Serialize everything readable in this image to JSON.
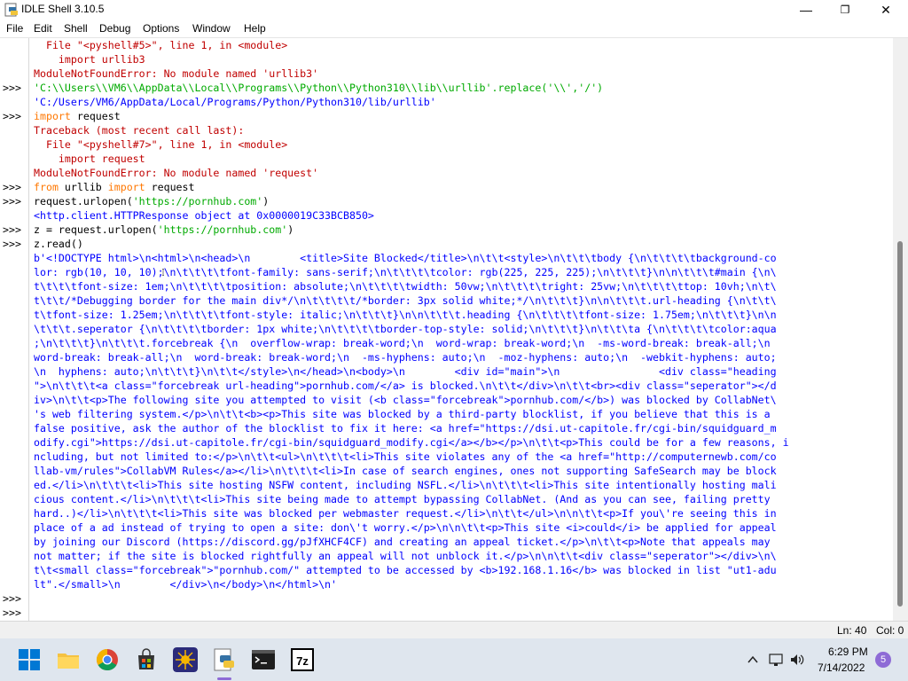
{
  "window": {
    "title": "IDLE Shell 3.10.5",
    "controls": {
      "minimize": "—",
      "maximize": "❐",
      "close": "✕"
    }
  },
  "menu": [
    "File",
    "Edit",
    "Shell",
    "Debug",
    "Options",
    "Window",
    "Help"
  ],
  "shell": {
    "prompts": [
      ">>>",
      ">>>",
      ">>>",
      ">>>",
      ">>>",
      ">>>",
      ">>>",
      ">>>"
    ],
    "lines": [
      {
        "cls": "c-red",
        "text": "  File \"<pyshell#5>\", line 1, in <module>"
      },
      {
        "cls": "c-red",
        "text": "    import urllib3"
      },
      {
        "cls": "c-red",
        "text": "ModuleNotFoundError: No module named 'urllib3'"
      },
      {
        "cls": "c-grn",
        "text": "'C:\\\\Users\\\\VM6\\\\AppData\\\\Local\\\\Programs\\\\Python\\\\Python310\\\\lib\\\\urllib'.replace('\\\\','/')"
      },
      {
        "cls": "c-blue",
        "text": "'C:/Users/VM6/AppData/Local/Programs/Python/Python310/lib/urllib'"
      },
      {
        "cls": "c-blk",
        "text": "import request"
      },
      {
        "cls": "c-red",
        "text": "Traceback (most recent call last):"
      },
      {
        "cls": "c-red",
        "text": "  File \"<pyshell#7>\", line 1, in <module>"
      },
      {
        "cls": "c-red",
        "text": "    import request"
      },
      {
        "cls": "c-red",
        "text": "ModuleNotFoundError: No module named 'request'"
      },
      {
        "cls": "c-blk",
        "text": "from urllib import request"
      },
      {
        "cls": "c-blk",
        "text": "request.urlopen('https://pornhub.com')"
      },
      {
        "cls": "c-blue",
        "text": "<http.client.HTTPResponse object at 0x0000019C33BCB850>"
      },
      {
        "cls": "c-blk",
        "text": "z = request.urlopen('https://pornhub.com')"
      },
      {
        "cls": "c-blk",
        "text": "z.read()"
      },
      {
        "cls": "c-blue",
        "text": "b'<!DOCTYPE html>\\n<html>\\n<head>\\n        <title>Site Blocked</title>\\n\\t\\t<style>\\n\\t\\t\\tbody {\\n\\t\\t\\t\\tbackground-co"
      },
      {
        "cls": "c-blue",
        "text": "lor: rgb(10, 10, 10);\\n\\t\\t\\t\\tfont-family: sans-serif;\\n\\t\\t\\t\\tcolor: rgb(225, 225, 225);\\n\\t\\t\\t}\\n\\n\\t\\t\\t#main {\\n\\"
      },
      {
        "cls": "c-blue",
        "text": "t\\t\\t\\tfont-size: 1em;\\n\\t\\t\\t\\tposition: absolute;\\n\\t\\t\\t\\twidth: 50vw;\\n\\t\\t\\t\\tright: 25vw;\\n\\t\\t\\t\\ttop: 10vh;\\n\\t\\"
      },
      {
        "cls": "c-blue",
        "text": "t\\t\\t/*Debugging border for the main div*/\\n\\t\\t\\t\\t/*border: 3px solid white;*/\\n\\t\\t\\t}\\n\\n\\t\\t\\t.url-heading {\\n\\t\\t\\"
      },
      {
        "cls": "c-blue",
        "text": "t\\tfont-size: 1.25em;\\n\\t\\t\\t\\tfont-style: italic;\\n\\t\\t\\t}\\n\\n\\t\\t\\t.heading {\\n\\t\\t\\t\\tfont-size: 1.75em;\\n\\t\\t\\t}\\n\\n"
      },
      {
        "cls": "c-blue",
        "text": "\\t\\t\\t.seperator {\\n\\t\\t\\t\\tborder: 1px white;\\n\\t\\t\\t\\tborder-top-style: solid;\\n\\t\\t\\t}\\n\\t\\t\\ta {\\n\\t\\t\\t\\tcolor:aqua"
      },
      {
        "cls": "c-blue",
        "text": ";\\n\\t\\t\\t}\\n\\t\\t\\t.forcebreak {\\n  overflow-wrap: break-word;\\n  word-wrap: break-word;\\n  -ms-word-break: break-all;\\n"
      },
      {
        "cls": "c-blue",
        "text": "word-break: break-all;\\n  word-break: break-word;\\n  -ms-hyphens: auto;\\n  -moz-hyphens: auto;\\n  -webkit-hyphens: auto;"
      },
      {
        "cls": "c-blue",
        "text": "\\n  hyphens: auto;\\n\\t\\t\\t}\\n\\t\\t</style>\\n</head>\\n<body>\\n        <div id=\"main\">\\n                <div class=\"heading"
      },
      {
        "cls": "c-blue",
        "text": "\">\\n\\t\\t\\t<a class=\"forcebreak url-heading\">pornhub.com/</a> is blocked.\\n\\t\\t</div>\\n\\t\\t<br><div class=\"seperator\"></d"
      },
      {
        "cls": "c-blue",
        "text": "iv>\\n\\t\\t<p>The following site you attempted to visit (<b class=\"forcebreak\">pornhub.com/</b>) was blocked by CollabNet\\"
      },
      {
        "cls": "c-blue",
        "text": "'s web filtering system.</p>\\n\\t\\t<b><p>This site was blocked by a third-party blocklist, if you believe that this is a"
      },
      {
        "cls": "c-blue",
        "text": "false positive, ask the author of the blocklist to fix it here: <a href=\"https://dsi.ut-capitole.fr/cgi-bin/squidguard_m"
      },
      {
        "cls": "c-blue",
        "text": "odify.cgi\">https://dsi.ut-capitole.fr/cgi-bin/squidguard_modify.cgi</a></b></p>\\n\\t\\t<p>This could be for a few reasons, i"
      },
      {
        "cls": "c-blue",
        "text": "ncluding, but not limited to:</p>\\n\\t\\t<ul>\\n\\t\\t\\t<li>This site violates any of the <a href=\"http://computernewb.com/co"
      },
      {
        "cls": "c-blue",
        "text": "llab-vm/rules\">CollabVM Rules</a></li>\\n\\t\\t\\t<li>In case of search engines, ones not supporting SafeSearch may be block"
      },
      {
        "cls": "c-blue",
        "text": "ed.</li>\\n\\t\\t\\t<li>This site hosting NSFW content, including NSFL.</li>\\n\\t\\t\\t<li>This site intentionally hosting mali"
      },
      {
        "cls": "c-blue",
        "text": "cious content.</li>\\n\\t\\t\\t<li>This site being made to attempt bypassing CollabNet. (And as you can see, failing pretty"
      },
      {
        "cls": "c-blue",
        "text": "hard..)</li>\\n\\t\\t\\t<li>This site was blocked per webmaster request.</li>\\n\\t\\t</ul>\\n\\n\\t\\t<p>If you\\'re seeing this in"
      },
      {
        "cls": "c-blue",
        "text": "place of a ad instead of trying to open a site: don\\'t worry.</p>\\n\\n\\t\\t<p>This site <i>could</i> be applied for appeal"
      },
      {
        "cls": "c-blue",
        "text": "by joining our Discord (https://discord.gg/pJfXHCF4CF) and creating an appeal ticket.</p>\\n\\t\\t<p>Note that appeals may"
      },
      {
        "cls": "c-blue",
        "text": "not matter; if the site is blocked rightfully an appeal will not unblock it.</p>\\n\\n\\t\\t<div class=\"seperator\"></div>\\n\\"
      },
      {
        "cls": "c-blue",
        "text": "t\\t<small class=\"forcebreak\">\"pornhub.com/\" attempted to be accessed by <b>192.168.1.16</b> was blocked in list \"ut1-adu"
      },
      {
        "cls": "c-blue",
        "text": "lt\".</small>\\n        </div>\\n</body>\\n</html>\\n'"
      },
      {
        "cls": "c-blk",
        "text": ""
      },
      {
        "cls": "c-blk",
        "text": ""
      }
    ]
  },
  "status": {
    "line": "Ln: 40",
    "col": "Col: 0"
  },
  "taskbar": {
    "icons": [
      "windows-start-icon",
      "file-explorer-icon",
      "chrome-icon",
      "store-icon",
      "burst-app-icon",
      "python-idle-icon",
      "terminal-icon",
      "7zip-icon"
    ],
    "time": "6:29 PM",
    "date": "7/14/2022",
    "notifications": "5",
    "colors": {
      "taskbar": "#dfe6ee",
      "accent": "#0078d4"
    }
  }
}
